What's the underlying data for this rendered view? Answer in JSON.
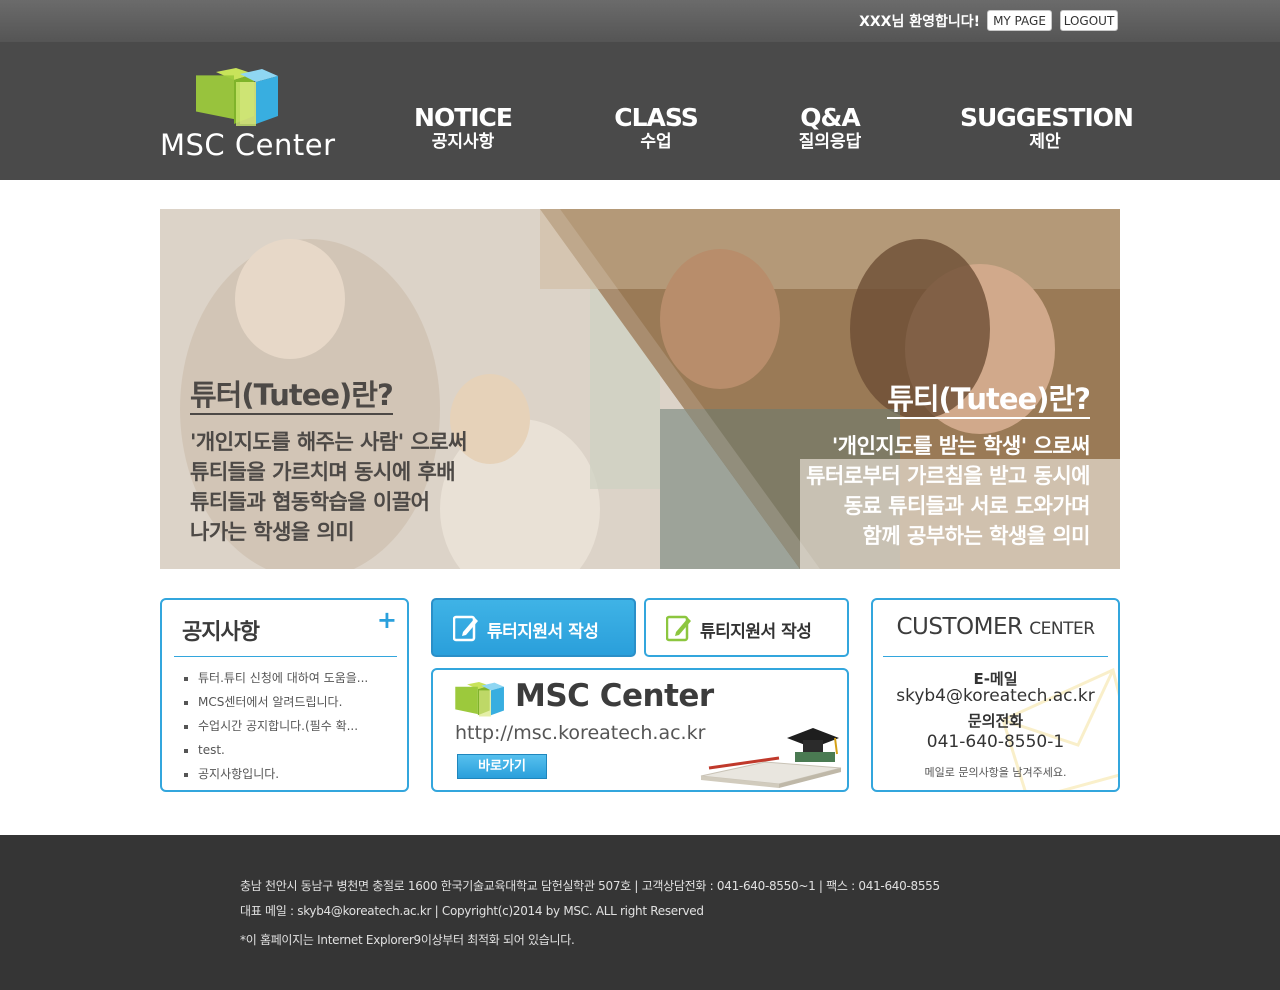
{
  "topbar": {
    "welcome": "XXX님 환영합니다!",
    "mypage_label": "MY PAGE",
    "logout_label": "LOGOUT"
  },
  "header": {
    "logo_text": "MSC Center",
    "nav": [
      {
        "en": "NOTICE",
        "ko": "공지사항"
      },
      {
        "en": "CLASS",
        "ko": "수업"
      },
      {
        "en": "Q&A",
        "ko": "질의응답"
      },
      {
        "en": "SUGGESTION",
        "ko": "제안"
      }
    ]
  },
  "hero": {
    "tutor_title": "튜터(Tutee)란?",
    "tutor_lines": [
      "'개인지도를 해주는 사람' 으로써",
      "튜티들을 가르치며 동시에 후배",
      "튜티들과 협동학습을 이끌어",
      "나가는 학생을 의미"
    ],
    "tutee_title": "튜티(Tutee)란?",
    "tutee_lines": [
      "'개인지도를 받는 학생' 으로써",
      "튜터로부터 가르침을 받고 동시에",
      "동료 튜티들과 서로 도와가며",
      "함께 공부하는 학생을 의미"
    ]
  },
  "notice": {
    "title": "공지사항",
    "more": "+",
    "items": [
      "튜터.튜티 신청에 대하여 도움을...",
      "MCS센터에서 알려드립니다.",
      "수업시간 공지합니다.(필수 확...",
      "test.",
      "공지사항입니다."
    ]
  },
  "apply": {
    "tutor_label": "튜터지원서 작성",
    "tutee_label": "튜티지원서 작성"
  },
  "msc": {
    "title": "MSC Center",
    "url": "http://msc.koreatech.ac.kr",
    "go_label": "바로가기"
  },
  "customer": {
    "title_main": "CUSTOMER",
    "title_sub": "CENTER",
    "email_label": "E-메일",
    "email": "skyb4@koreatech.ac.kr",
    "phone_label": "문의전화",
    "phone": "041-640-8550-1",
    "note": "메일로 문의사항을 남겨주세요."
  },
  "footer": {
    "line1": "충남 천안시 동남구 병천면 충절로 1600 한국기술교육대학교 담헌실학관 507호  |  고객상담전화 : 041-640-8550~1  |  팩스 : 041-640-8555",
    "line2": "대표 메일 : skyb4@koreatech.ac.kr  |  Copyright(c)2014 by MSC. ALL right Reserved",
    "line3": "*이 홈페이지는 Internet Explorer9이상부터 최적화 되어 있습니다."
  },
  "colors": {
    "accent": "#33a6dd",
    "header_bg": "#4a4a4a",
    "footer_bg": "#353535"
  }
}
